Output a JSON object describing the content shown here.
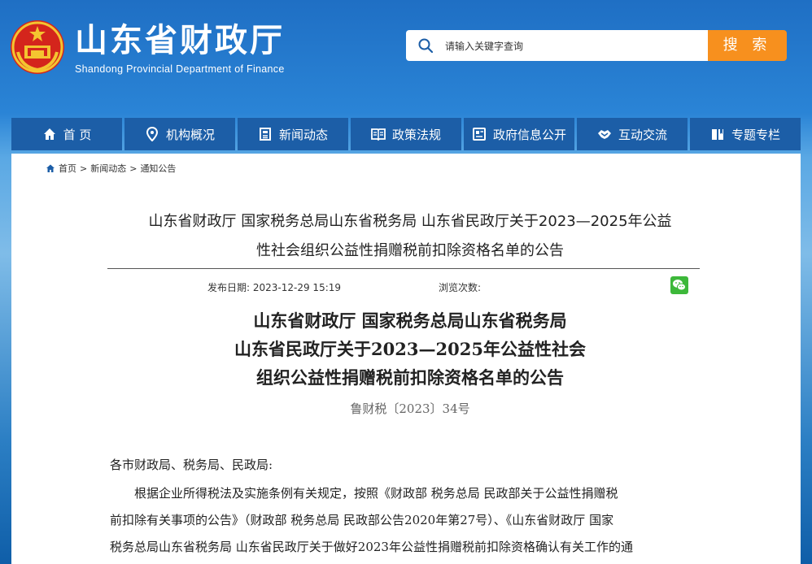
{
  "header": {
    "site_title": "山东省财政厅",
    "site_subtitle": "Shandong Provincial Department of Finance",
    "search_placeholder": "请输入关键字查询",
    "search_button": "搜 索"
  },
  "nav": {
    "items": [
      {
        "label": "首 页",
        "icon": "home-icon"
      },
      {
        "label": "机构概况",
        "icon": "location-pin-icon"
      },
      {
        "label": "新闻动态",
        "icon": "newspaper-icon"
      },
      {
        "label": "政策法规",
        "icon": "book-icon"
      },
      {
        "label": "政府信息公开",
        "icon": "document-icon"
      },
      {
        "label": "互动交流",
        "icon": "handshake-icon"
      },
      {
        "label": "专题专栏",
        "icon": "bookmark-book-icon"
      }
    ]
  },
  "breadcrumb": {
    "home": "首页",
    "sep": ">",
    "section": "新闻动态",
    "current": "通知公告"
  },
  "article": {
    "title_line1": "山东省财政厅 国家税务总局山东省税务局 山东省民政厅关于2023—2025年公益",
    "title_line2": "性社会组织公益性捐赠税前扣除资格名单的公告",
    "publish_label": "发布日期:",
    "publish_date": "2023-12-29 15:19",
    "views_label": "浏览次数:",
    "doc_title_line1": "山东省财政厅 国家税务总局山东省税务局",
    "doc_title_line2": "山东省民政厅关于2023—2025年公益性社会",
    "doc_title_line3": "组织公益性捐赠税前扣除资格名单的公告",
    "doc_number": "鲁财税〔2023〕34号",
    "salutation": "各市财政局、税务局、民政局:",
    "para1_line1": "根据企业所得税法及实施条例有关规定，按照《财政部 税务总局 民政部关于公益性捐赠税",
    "para1_line2": "前扣除有关事项的公告》（财政部 税务总局 民政部公告2020年第27号）、《山东省财政厅 国家",
    "para1_line3": "税务总局山东省税务局 山东省民政厅关于做好2023年公益性捐赠税前扣除资格确认有关工作的通"
  },
  "colors": {
    "nav_bg": "#1c5ea7",
    "search_button": "#f7901e",
    "header_text": "#ffffff"
  }
}
